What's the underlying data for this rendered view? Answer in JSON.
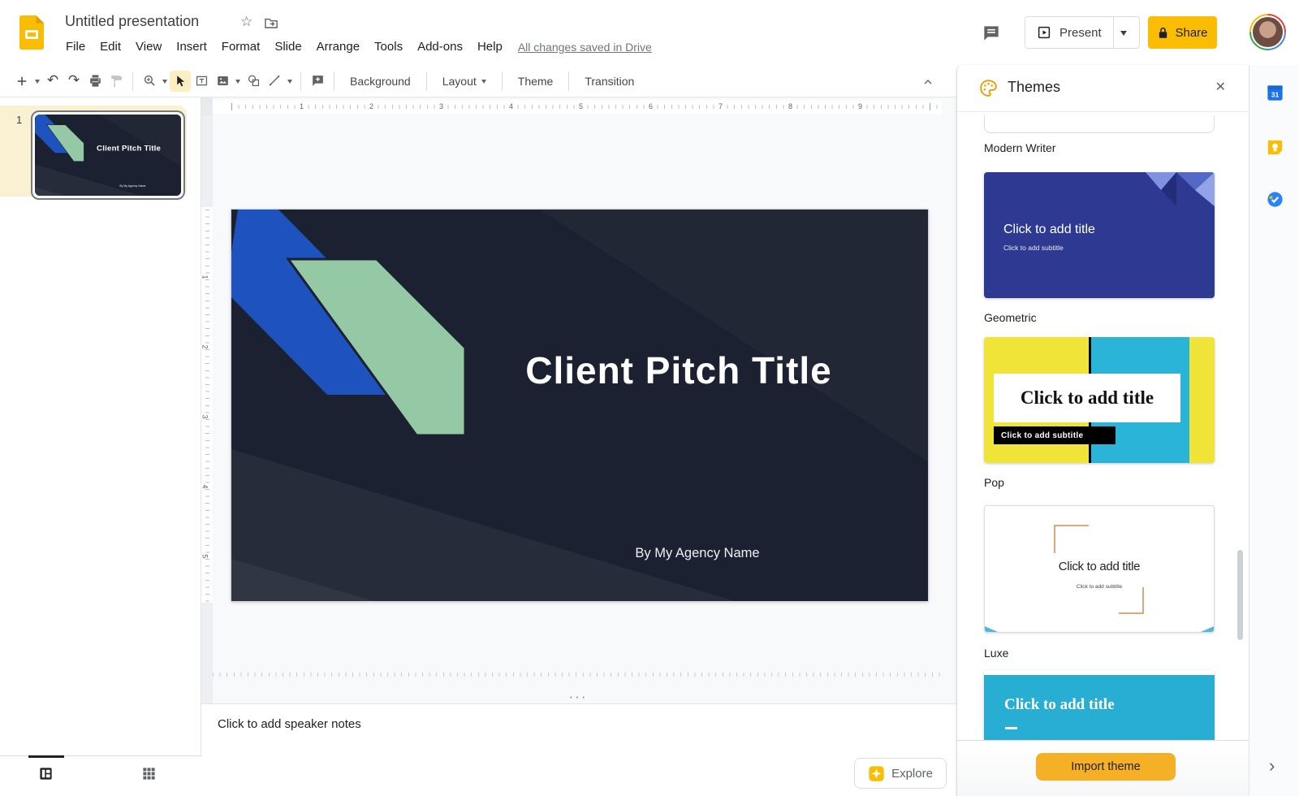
{
  "icons": {
    "star": "☆",
    "close": "✕",
    "chevron_right": "›",
    "dots_handle": "···"
  },
  "colors": {
    "accent_yellow": "#fbbc04",
    "import_yellow": "#f6b026",
    "selected_highlight": "#faf0d2",
    "selected_tool": "#feefc3",
    "slide_bg": "#1b2130",
    "slide_blue": "#1e53bf",
    "slide_green": "#95c9a5",
    "theme_geometric_blue": "#2e3a92",
    "theme_pop_yellow": "#f1e438",
    "theme_pop_cyan": "#2ab5d8",
    "theme_luxe_accent": "#d8a97e",
    "theme_teal": "#29aed3"
  },
  "header": {
    "doc_title": "Untitled presentation",
    "menu_items": [
      "File",
      "Edit",
      "View",
      "Insert",
      "Format",
      "Slide",
      "Arrange",
      "Tools",
      "Add-ons",
      "Help"
    ],
    "save_status": "All changes saved in Drive",
    "present_label": "Present",
    "share_label": "Share"
  },
  "toolbar": {
    "background_label": "Background",
    "layout_label": "Layout",
    "theme_label": "Theme",
    "transition_label": "Transition"
  },
  "filmstrip": {
    "slide_number": "1"
  },
  "slide": {
    "title": "Client Pitch Title",
    "subtitle": "By My Agency Name"
  },
  "rulers": {
    "h": [
      "1",
      "2",
      "3",
      "4",
      "5",
      "6",
      "7",
      "8",
      "9"
    ],
    "v": [
      "1",
      "2",
      "3",
      "4",
      "5"
    ]
  },
  "notes": {
    "placeholder": "Click to add speaker notes"
  },
  "explore": {
    "label": "Explore"
  },
  "themes_panel": {
    "title": "Themes",
    "import_label": "Import theme",
    "themes": [
      {
        "name": "Modern Writer"
      },
      {
        "name": "Geometric",
        "title_placeholder": "Click to add title",
        "subtitle_placeholder": "Click to add subtitle"
      },
      {
        "name": "Pop",
        "title_placeholder": "Click to add title",
        "subtitle_placeholder": "Click to add subtitle"
      },
      {
        "name": "Luxe",
        "title_placeholder": "Click to add title",
        "subtitle_placeholder": "Click to add subtitle"
      },
      {
        "name": "",
        "title_placeholder": "Click to add title"
      }
    ]
  },
  "side_strip": {
    "calendar_label": "31"
  }
}
